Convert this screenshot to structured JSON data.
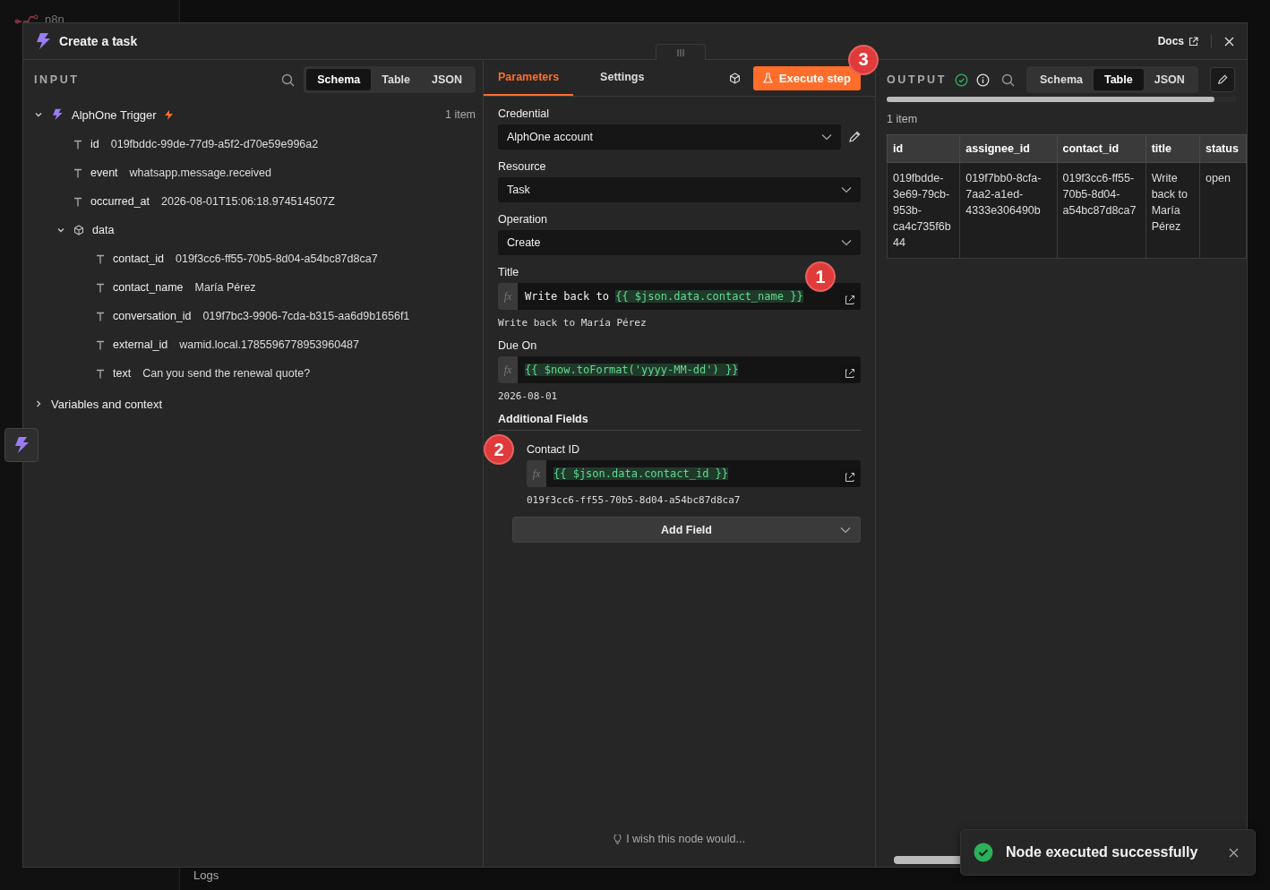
{
  "background": {
    "logo": "n8n",
    "bottom_tab": "Logs"
  },
  "dialog": {
    "title": "Create a task",
    "docs_link": "Docs"
  },
  "input": {
    "heading": "INPUT",
    "views": [
      {
        "label": "Schema",
        "selected": true
      },
      {
        "label": "Table",
        "selected": false
      },
      {
        "label": "JSON",
        "selected": false
      }
    ],
    "node": {
      "name": "AlphOne Trigger",
      "count": "1 item",
      "expanded": true,
      "fields": [
        {
          "kind": "text",
          "key": "id",
          "value": "019fbddc-99de-77d9-a5f2-d70e59e996a2"
        },
        {
          "kind": "text",
          "key": "event",
          "value": "whatsapp.message.received"
        },
        {
          "kind": "text",
          "key": "occurred_at",
          "value": "2026-08-01T15:06:18.974514507Z"
        },
        {
          "kind": "object",
          "key": "data",
          "expanded": true,
          "children": [
            {
              "kind": "text",
              "key": "contact_id",
              "value": "019f3cc6-ff55-70b5-8d04-a54bc87d8ca7"
            },
            {
              "kind": "text",
              "key": "contact_name",
              "value": "María Pérez"
            },
            {
              "kind": "text",
              "key": "conversation_id",
              "value": "019f7bc3-9906-7cda-b315-aa6d9b1656f1"
            },
            {
              "kind": "text",
              "key": "external_id",
              "value": "wamid.local.1785596778953960487"
            },
            {
              "kind": "text",
              "key": "text",
              "value": "Can you send the renewal quote?"
            }
          ]
        }
      ]
    },
    "variables": {
      "label": "Variables and context",
      "expanded": false
    }
  },
  "parameters": {
    "tabs": [
      {
        "label": "Parameters",
        "selected": true
      },
      {
        "label": "Settings",
        "selected": false
      }
    ],
    "execute_button": "Execute step",
    "execute_callout": "3",
    "fields": [
      {
        "kind": "select",
        "label": "Credential",
        "value": "AlphOne account",
        "editable": true
      },
      {
        "kind": "select",
        "label": "Resource",
        "value": "Task",
        "editable": false
      },
      {
        "kind": "select",
        "label": "Operation",
        "value": "Create",
        "editable": false
      },
      {
        "kind": "expression",
        "label": "Title",
        "badge": "fx",
        "parts": [
          {
            "text": "Write back to ",
            "expr": false
          },
          {
            "text": "{{ $json.data.contact_name }}",
            "expr": true
          }
        ],
        "preview": "Write back to María Pérez",
        "callout": "1"
      },
      {
        "kind": "expression",
        "label": "Due On",
        "badge": "fx",
        "parts": [
          {
            "text": "{{ $now.toFormat('yyyy-MM-dd') }}",
            "expr": true
          }
        ],
        "preview": "2026-08-01"
      }
    ],
    "additional": {
      "heading": "Additional Fields",
      "callout": "2",
      "fields": [
        {
          "kind": "expression",
          "label": "Contact ID",
          "badge": "fx",
          "parts": [
            {
              "text": "{{ $json.data.contact_id }}",
              "expr": true
            }
          ],
          "preview": "019f3cc6-ff55-70b5-8d04-a54bc87d8ca7"
        }
      ],
      "add_button": "Add Field"
    },
    "feedback": "I wish this node would..."
  },
  "output": {
    "heading": "OUTPUT",
    "success": true,
    "views": [
      {
        "label": "Schema",
        "selected": false
      },
      {
        "label": "Table",
        "selected": true
      },
      {
        "label": "JSON",
        "selected": false
      }
    ],
    "count": "1 item",
    "table": {
      "columns": [
        "id",
        "assignee_id",
        "contact_id",
        "title",
        "status"
      ],
      "rows": [
        [
          "019fbdde-3e69-79cb-953b-ca4c735f6b44",
          "019f7bb0-8cfa-7aa2-a1ed-4333e306490b",
          "019f3cc6-ff55-70b5-8d04-a54bc87d8ca7",
          "Write back to María Pérez",
          "open"
        ]
      ]
    }
  },
  "toast": {
    "message": "Node executed successfully"
  }
}
